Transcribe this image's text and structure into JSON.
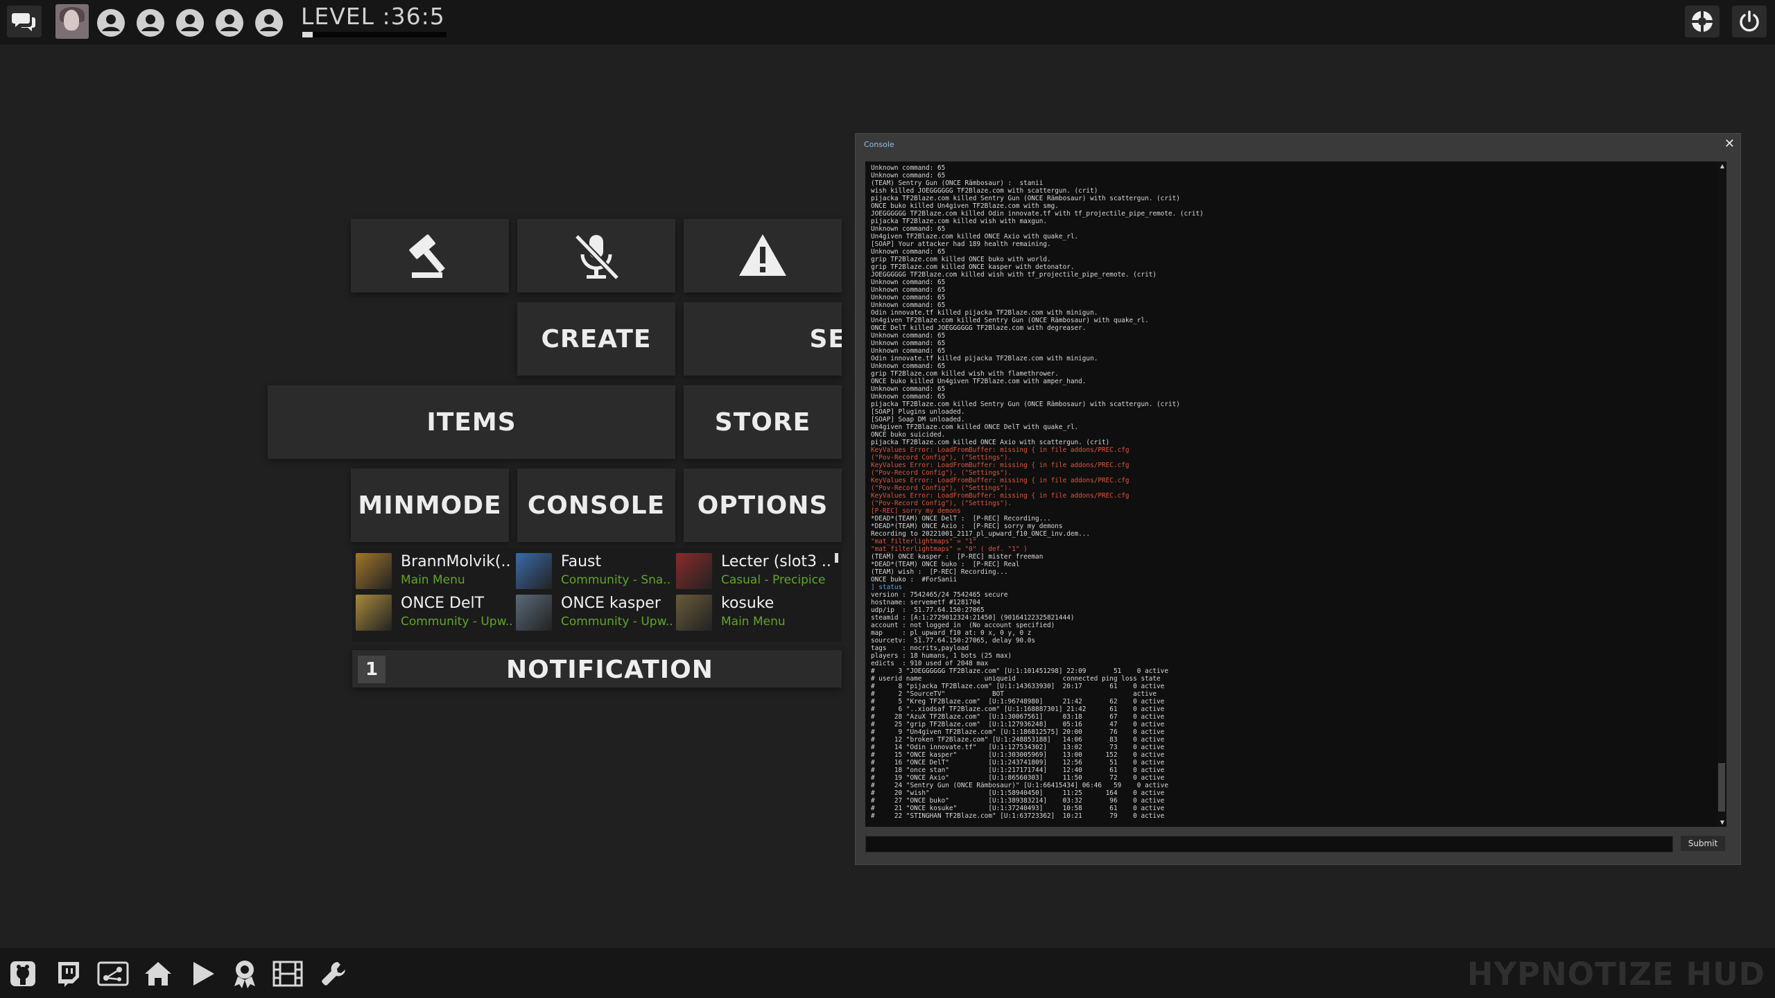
{
  "topbar": {
    "level_text": "LEVEL :36:5",
    "xp_progress": 0.07,
    "icons": [
      "chat-icon",
      "user-avatar",
      "party-slot-icon",
      "party-slot-icon",
      "party-slot-icon",
      "party-slot-icon",
      "party-slot-icon",
      "settings-wheel-icon",
      "power-icon"
    ]
  },
  "menu": {
    "create": "CREATE",
    "server_browser_partial": "SE",
    "items": "ITEMS",
    "store": "STORE",
    "minmode": "MINMODE",
    "console": "CONSOLE",
    "options": "OPTIONS",
    "icon_buttons": [
      "gavel-icon",
      "mic-mute-icon",
      "warning-icon"
    ]
  },
  "friends": [
    {
      "name": "BrannMolvik(...",
      "status": "Main Menu",
      "color": "#a0752a"
    },
    {
      "name": "Faust",
      "status": "Community - Sna...",
      "color": "#3a6aa8"
    },
    {
      "name": "Lecter (slot3 ...",
      "status": "Casual - Precipice",
      "color": "#8a2a2a"
    },
    {
      "name": "ONCE DelT",
      "status": "Community - Upw...",
      "color": "#a88a3a"
    },
    {
      "name": "ONCE kasper",
      "status": "Community - Upw...",
      "color": "#5a6a7a"
    },
    {
      "name": "kosuke",
      "status": "Main Menu",
      "color": "#6a5a3a"
    }
  ],
  "notification": {
    "count": "1",
    "label": "NOTIFICATION"
  },
  "console": {
    "title": "Console",
    "close": "✕",
    "submit": "Submit",
    "input_value": "",
    "lines": [
      {
        "t": "Unknown command: 65",
        "c": "n"
      },
      {
        "t": "Unknown command: 65",
        "c": "n"
      },
      {
        "t": "(TEAM) Sentry Gun (ONCE Rämbosaur) :  stanii",
        "c": "n"
      },
      {
        "t": "wish killed JOEGGGGGG TF2Blaze.com with scattergun. (crit)",
        "c": "n"
      },
      {
        "t": "pijacka TF2Blaze.com killed Sentry Gun (ONCE Rämbosaur) with scattergun. (crit)",
        "c": "n"
      },
      {
        "t": "ONCE buko killed Un4given TF2Blaze.com with smg.",
        "c": "n"
      },
      {
        "t": "JOEGGGGGG TF2Blaze.com killed Odin innovate.tf with tf_projectile_pipe_remote. (crit)",
        "c": "n"
      },
      {
        "t": "pijacka TF2Blaze.com killed wish with maxgun.",
        "c": "n"
      },
      {
        "t": "Unknown command: 65",
        "c": "n"
      },
      {
        "t": "Un4given TF2Blaze.com killed ONCE Axio with quake_rl.",
        "c": "n"
      },
      {
        "t": "[SOAP] Your attacker had 189 health remaining.",
        "c": "n"
      },
      {
        "t": "Unknown command: 65",
        "c": "n"
      },
      {
        "t": "grip TF2Blaze.com killed ONCE buko with world.",
        "c": "n"
      },
      {
        "t": "grip TF2Blaze.com killed ONCE kasper with detonator.",
        "c": "n"
      },
      {
        "t": "JOEGGGGGG TF2Blaze.com killed wish with tf_projectile_pipe_remote. (crit)",
        "c": "n"
      },
      {
        "t": "Unknown command: 65",
        "c": "n"
      },
      {
        "t": "Unknown command: 65",
        "c": "n"
      },
      {
        "t": "Unknown command: 65",
        "c": "n"
      },
      {
        "t": "Unknown command: 65",
        "c": "n"
      },
      {
        "t": "Odin innovate.tf killed pijacka TF2Blaze.com with minigun.",
        "c": "n"
      },
      {
        "t": "Un4given TF2Blaze.com killed Sentry Gun (ONCE Rämbosaur) with quake_rl.",
        "c": "n"
      },
      {
        "t": "ONCE DelT killed JOEGGGGGG TF2Blaze.com with degreaser.",
        "c": "n"
      },
      {
        "t": "Unknown command: 65",
        "c": "n"
      },
      {
        "t": "Unknown command: 65",
        "c": "n"
      },
      {
        "t": "Unknown command: 65",
        "c": "n"
      },
      {
        "t": "Odin innovate.tf killed pijacka TF2Blaze.com with minigun.",
        "c": "n"
      },
      {
        "t": "Unknown command: 65",
        "c": "n"
      },
      {
        "t": "grip TF2Blaze.com killed wish with flamethrower.",
        "c": "n"
      },
      {
        "t": "ONCE buko killed Un4given TF2Blaze.com with amper_hand.",
        "c": "n"
      },
      {
        "t": "Unknown command: 65",
        "c": "n"
      },
      {
        "t": "Unknown command: 65",
        "c": "n"
      },
      {
        "t": "pijacka TF2Blaze.com killed Sentry Gun (ONCE Rämbosaur) with scattergun. (crit)",
        "c": "n"
      },
      {
        "t": "[SOAP] Plugins unloaded.",
        "c": "n"
      },
      {
        "t": "[SOAP] Soap DM unloaded.",
        "c": "n"
      },
      {
        "t": "Un4given TF2Blaze.com killed ONCE DelT with quake_rl.",
        "c": "n"
      },
      {
        "t": "ONCE buko suicided.",
        "c": "n"
      },
      {
        "t": "pijacka TF2Blaze.com killed ONCE Axio with scattergun. (crit)",
        "c": "n"
      },
      {
        "t": "KeyValues Error: LoadFromBuffer: missing { in file addons/PREC.cfg",
        "c": "e"
      },
      {
        "t": "(\"Pov-Record Config\"), (\"Settings\").",
        "c": "e"
      },
      {
        "t": "KeyValues Error: LoadFromBuffer: missing { in file addons/PREC.cfg",
        "c": "e"
      },
      {
        "t": "(\"Pov-Record Config\"), (\"Settings\").",
        "c": "e"
      },
      {
        "t": "KeyValues Error: LoadFromBuffer: missing { in file addons/PREC.cfg",
        "c": "e"
      },
      {
        "t": "(\"Pov-Record Config\"), (\"Settings\").",
        "c": "e"
      },
      {
        "t": "KeyValues Error: LoadFromBuffer: missing { in file addons/PREC.cfg",
        "c": "e"
      },
      {
        "t": "(\"Pov-Record Config\"), (\"Settings\").",
        "c": "e"
      },
      {
        "t": "[P-REC] sorry my demons",
        "c": "e"
      },
      {
        "t": "*DEAD*(TEAM) ONCE DelT :  [P-REC] Recording...",
        "c": "n"
      },
      {
        "t": "*DEAD*(TEAM) ONCE Axio :  [P-REC] sorry my demons",
        "c": "n"
      },
      {
        "t": "Recording to 20221001_2117_pl_upward_f10_ONCE_inv.dem...",
        "c": "n"
      },
      {
        "t": "\"mat_filterlightmaps\" = \"1\"",
        "c": "e"
      },
      {
        "t": "\"mat_filterlightmaps\" = \"0\" ( def. \"1\" )",
        "c": "e"
      },
      {
        "t": "(TEAM) ONCE kasper :  [P-REC] mister freeman",
        "c": "n"
      },
      {
        "t": "*DEAD*(TEAM) ONCE buko :  [P-REC] Real",
        "c": "n"
      },
      {
        "t": "(TEAM) wish :  [P-REC] Recording...",
        "c": "n"
      },
      {
        "t": "ONCE buko :  #ForSanii",
        "c": "n"
      },
      {
        "t": "] status",
        "c": "c"
      },
      {
        "t": "version : 7542465/24 7542465 secure",
        "c": "n"
      },
      {
        "t": "hostname: servemetf #1281704",
        "c": "n"
      },
      {
        "t": "udp/ip  :  51.77.64.150:27065",
        "c": "n"
      },
      {
        "t": "steamid : [A:1:2729012324:21450] (90164122325821444)",
        "c": "n"
      },
      {
        "t": "account : not logged in  (No account specified)",
        "c": "n"
      },
      {
        "t": "map     : pl_upward_f10 at: 0 x, 0 y, 0 z",
        "c": "n"
      },
      {
        "t": "sourcetv:  51.77.64.150:27065, delay 90.0s",
        "c": "n"
      },
      {
        "t": "tags    : nocrits,payload",
        "c": "n"
      },
      {
        "t": "players : 18 humans, 1 bots (25 max)",
        "c": "n"
      },
      {
        "t": "edicts  : 910 used of 2048 max",
        "c": "n"
      },
      {
        "t": "#      3 \"JOEGGGGGG TF2Blaze.com\" [U:1:101451298] 22:09       51    0 active",
        "c": "n"
      },
      {
        "t": "# userid name                uniqueid            connected ping loss state",
        "c": "n"
      },
      {
        "t": "#      8 \"pijacka TF2Blaze.com\" [U:1:143633930]  20:17       61    0 active",
        "c": "n"
      },
      {
        "t": "#      2 \"SourceTV\"            BOT                                 active",
        "c": "n"
      },
      {
        "t": "#      5 \"Kreg TF2Blaze.com\"  [U:1:96748980]     21:42       62    0 active",
        "c": "n"
      },
      {
        "t": "#      6 \"..xiodsaf TF2Blaze.com\" [U:1:168887301] 21:42      61    0 active",
        "c": "n"
      },
      {
        "t": "#     28 \"AzuX TF2Blaze.com\"  [U:1:30067561]     03:18       67    0 active",
        "c": "n"
      },
      {
        "t": "#     25 \"grip TF2Blaze.com\"  [U:1:127936248]    05:16       47    0 active",
        "c": "n"
      },
      {
        "t": "#      9 \"Un4given TF2Blaze.com\" [U:1:186812575] 20:00       76    0 active",
        "c": "n"
      },
      {
        "t": "#     12 \"broken TF2Blaze.com\" [U:1:248853188]   14:06       83    0 active",
        "c": "n"
      },
      {
        "t": "#     14 \"Odin innovate.tf\"   [U:1:127534302]    13:02       73    0 active",
        "c": "n"
      },
      {
        "t": "#     15 \"ONCE kasper\"        [U:1:303005969]    13:00      152    0 active",
        "c": "n"
      },
      {
        "t": "#     16 \"ONCE DelT\"          [U:1:243741809]    12:56       51    0 active",
        "c": "n"
      },
      {
        "t": "#     18 \"once stan\"          [U:1:217171744]    12:40       61    0 active",
        "c": "n"
      },
      {
        "t": "#     19 \"ONCE Axio\"          [U:1:86560303]     11:50       72    0 active",
        "c": "n"
      },
      {
        "t": "#     24 \"Sentry Gun (ONCE Rämbosaur)\" [U:1:66415434] 06:46   59    0 active",
        "c": "n"
      },
      {
        "t": "#     20 \"wish\"               [U:1:58940450]     11:25      164    0 active",
        "c": "n"
      },
      {
        "t": "#     27 \"ONCE buko\"          [U:1:389383214]    03:32       96    0 active",
        "c": "n"
      },
      {
        "t": "#     21 \"ONCE kosuke\"        [U:1:37240493]     10:58       61    0 active",
        "c": "n"
      },
      {
        "t": "#     22 \"STINGHAN TF2Blaze.com\" [U:1:63723362]  10:21       79    0 active",
        "c": "n"
      }
    ]
  },
  "bottombar": {
    "brand": "HYPNOTIZE HUD",
    "icons": [
      "github-icon",
      "twitch-icon",
      "server-share-icon",
      "home-icon",
      "play-icon",
      "achievement-icon",
      "film-icon",
      "wrench-icon"
    ]
  },
  "colors": {
    "tile": "#2b2b2b",
    "background": "#202020",
    "status_green": "#5fa52b",
    "console_error": "#e0553a"
  }
}
